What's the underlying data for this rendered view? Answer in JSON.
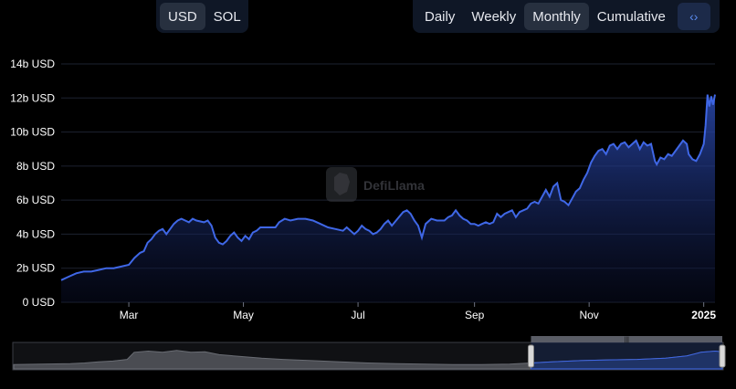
{
  "currency_toggle": {
    "options": [
      "USD",
      "SOL"
    ],
    "selected": "USD"
  },
  "period_toggle": {
    "options": [
      "Daily",
      "Weekly",
      "Monthly",
      "Cumulative"
    ],
    "selected": "Monthly"
  },
  "embed_icon": "code-brackets-icon",
  "watermark": {
    "text": "DefiLlama",
    "icon": "llama-logo-icon"
  },
  "colors": {
    "line": "#3f67e6",
    "area_top": "#2b4bb3",
    "background": "#000000",
    "brush_selected": "#1a2d59"
  },
  "chart_data": {
    "type": "area",
    "title": "",
    "xlabel": "",
    "ylabel": "",
    "y_ticks": [
      "0 USD",
      "2b USD",
      "4b USD",
      "6b USD",
      "8b USD",
      "10b USD",
      "12b USD",
      "14b USD"
    ],
    "ylim": [
      0,
      14
    ],
    "y_unit": "billion USD",
    "x_ticks": [
      {
        "label": "Mar",
        "day": 60,
        "bold": false
      },
      {
        "label": "May",
        "day": 121,
        "bold": false
      },
      {
        "label": "Jul",
        "day": 182,
        "bold": false
      },
      {
        "label": "Sep",
        "day": 244,
        "bold": false
      },
      {
        "label": "Nov",
        "day": 305,
        "bold": false
      },
      {
        "label": "2025",
        "day": 366,
        "bold": true
      }
    ],
    "grid": true,
    "series": [
      {
        "values_note": "daily trend-point (day of 2024, value in b USD)",
        "points": [
          [
            24,
            1.3
          ],
          [
            28,
            1.5
          ],
          [
            32,
            1.7
          ],
          [
            36,
            1.8
          ],
          [
            40,
            1.8
          ],
          [
            44,
            1.9
          ],
          [
            48,
            2.0
          ],
          [
            52,
            2.0
          ],
          [
            56,
            2.1
          ],
          [
            60,
            2.2
          ],
          [
            63,
            2.6
          ],
          [
            66,
            2.9
          ],
          [
            68,
            3.0
          ],
          [
            70,
            3.5
          ],
          [
            72,
            3.7
          ],
          [
            74,
            4.0
          ],
          [
            76,
            4.2
          ],
          [
            78,
            4.3
          ],
          [
            80,
            4.0
          ],
          [
            82,
            4.3
          ],
          [
            84,
            4.6
          ],
          [
            86,
            4.8
          ],
          [
            88,
            4.9
          ],
          [
            90,
            4.8
          ],
          [
            92,
            4.7
          ],
          [
            94,
            4.9
          ],
          [
            96,
            4.8
          ],
          [
            100,
            4.7
          ],
          [
            102,
            4.8
          ],
          [
            104,
            4.5
          ],
          [
            106,
            3.8
          ],
          [
            108,
            3.5
          ],
          [
            110,
            3.4
          ],
          [
            112,
            3.6
          ],
          [
            114,
            3.9
          ],
          [
            116,
            4.1
          ],
          [
            118,
            3.8
          ],
          [
            120,
            3.6
          ],
          [
            122,
            3.9
          ],
          [
            124,
            3.7
          ],
          [
            126,
            4.1
          ],
          [
            128,
            4.2
          ],
          [
            130,
            4.4
          ],
          [
            134,
            4.4
          ],
          [
            138,
            4.4
          ],
          [
            140,
            4.7
          ],
          [
            143,
            4.9
          ],
          [
            146,
            4.8
          ],
          [
            150,
            4.9
          ],
          [
            154,
            4.9
          ],
          [
            158,
            4.8
          ],
          [
            162,
            4.6
          ],
          [
            166,
            4.4
          ],
          [
            170,
            4.3
          ],
          [
            174,
            4.2
          ],
          [
            176,
            4.4
          ],
          [
            178,
            4.2
          ],
          [
            180,
            4.0
          ],
          [
            182,
            4.2
          ],
          [
            184,
            4.5
          ],
          [
            186,
            4.3
          ],
          [
            188,
            4.2
          ],
          [
            190,
            4.0
          ],
          [
            192,
            4.1
          ],
          [
            194,
            4.3
          ],
          [
            196,
            4.6
          ],
          [
            198,
            4.8
          ],
          [
            200,
            4.5
          ],
          [
            203,
            4.9
          ],
          [
            206,
            5.3
          ],
          [
            208,
            5.4
          ],
          [
            210,
            5.2
          ],
          [
            212,
            4.8
          ],
          [
            214,
            4.5
          ],
          [
            216,
            3.8
          ],
          [
            218,
            4.6
          ],
          [
            221,
            4.9
          ],
          [
            224,
            4.8
          ],
          [
            226,
            4.8
          ],
          [
            228,
            4.8
          ],
          [
            230,
            5.0
          ],
          [
            232,
            5.1
          ],
          [
            234,
            5.4
          ],
          [
            236,
            5.1
          ],
          [
            238,
            4.9
          ],
          [
            240,
            4.8
          ],
          [
            242,
            4.6
          ],
          [
            244,
            4.6
          ],
          [
            246,
            4.5
          ],
          [
            248,
            4.6
          ],
          [
            250,
            4.7
          ],
          [
            252,
            4.6
          ],
          [
            254,
            4.7
          ],
          [
            256,
            5.2
          ],
          [
            258,
            5.0
          ],
          [
            260,
            5.2
          ],
          [
            262,
            5.3
          ],
          [
            264,
            5.4
          ],
          [
            266,
            5.0
          ],
          [
            268,
            5.3
          ],
          [
            270,
            5.4
          ],
          [
            272,
            5.5
          ],
          [
            274,
            5.8
          ],
          [
            276,
            5.9
          ],
          [
            278,
            5.8
          ],
          [
            280,
            6.2
          ],
          [
            282,
            6.6
          ],
          [
            284,
            6.2
          ],
          [
            286,
            6.8
          ],
          [
            288,
            7.0
          ],
          [
            290,
            6.0
          ],
          [
            292,
            5.9
          ],
          [
            294,
            5.7
          ],
          [
            296,
            6.1
          ],
          [
            298,
            6.5
          ],
          [
            300,
            6.7
          ],
          [
            302,
            7.2
          ],
          [
            304,
            7.6
          ],
          [
            306,
            8.2
          ],
          [
            308,
            8.6
          ],
          [
            310,
            8.9
          ],
          [
            312,
            9.0
          ],
          [
            314,
            8.7
          ],
          [
            316,
            9.2
          ],
          [
            318,
            9.3
          ],
          [
            320,
            9.0
          ],
          [
            322,
            9.3
          ],
          [
            324,
            9.4
          ],
          [
            326,
            9.1
          ],
          [
            328,
            9.3
          ],
          [
            330,
            9.5
          ],
          [
            332,
            9.0
          ],
          [
            334,
            9.4
          ],
          [
            336,
            9.2
          ],
          [
            338,
            9.3
          ],
          [
            340,
            8.3
          ],
          [
            341,
            8.1
          ],
          [
            343,
            8.5
          ],
          [
            345,
            8.4
          ],
          [
            347,
            8.7
          ],
          [
            349,
            8.6
          ],
          [
            351,
            8.9
          ],
          [
            353,
            9.2
          ],
          [
            355,
            9.5
          ],
          [
            357,
            9.3
          ],
          [
            358,
            8.7
          ],
          [
            360,
            8.4
          ],
          [
            362,
            8.3
          ],
          [
            364,
            8.7
          ],
          [
            366,
            9.3
          ],
          [
            367,
            10.4
          ],
          [
            368,
            12.2
          ],
          [
            369,
            11.5
          ],
          [
            370,
            12.1
          ],
          [
            371,
            11.6
          ],
          [
            372,
            12.2
          ]
        ]
      }
    ]
  },
  "brush": {
    "selection_start_fraction": 0.73,
    "selection_end_fraction": 1.0,
    "handle_label": "|||",
    "overview_points": [
      [
        0,
        0.18
      ],
      [
        0.04,
        0.2
      ],
      [
        0.08,
        0.22
      ],
      [
        0.1,
        0.25
      ],
      [
        0.12,
        0.3
      ],
      [
        0.14,
        0.33
      ],
      [
        0.16,
        0.4
      ],
      [
        0.17,
        0.7
      ],
      [
        0.19,
        0.75
      ],
      [
        0.21,
        0.7
      ],
      [
        0.23,
        0.78
      ],
      [
        0.25,
        0.7
      ],
      [
        0.27,
        0.72
      ],
      [
        0.29,
        0.6
      ],
      [
        0.31,
        0.55
      ],
      [
        0.33,
        0.5
      ],
      [
        0.35,
        0.45
      ],
      [
        0.38,
        0.4
      ],
      [
        0.42,
        0.35
      ],
      [
        0.46,
        0.3
      ],
      [
        0.5,
        0.25
      ],
      [
        0.54,
        0.22
      ],
      [
        0.58,
        0.2
      ],
      [
        0.62,
        0.18
      ],
      [
        0.66,
        0.18
      ],
      [
        0.7,
        0.2
      ],
      [
        0.73,
        0.25
      ],
      [
        0.76,
        0.3
      ],
      [
        0.8,
        0.35
      ],
      [
        0.84,
        0.38
      ],
      [
        0.88,
        0.4
      ],
      [
        0.92,
        0.45
      ],
      [
        0.95,
        0.55
      ],
      [
        0.97,
        0.7
      ],
      [
        0.99,
        0.75
      ],
      [
        1.0,
        0.72
      ]
    ]
  }
}
